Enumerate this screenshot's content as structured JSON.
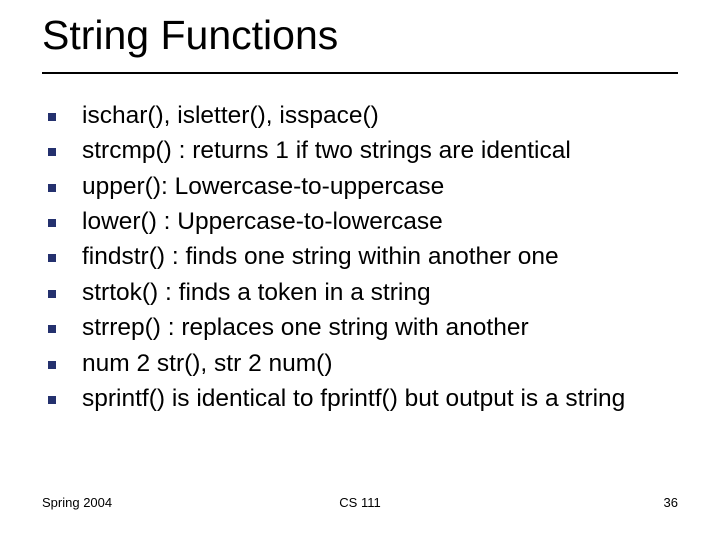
{
  "title": "String Functions",
  "bullets": [
    "ischar(), isletter(), isspace()",
    "strcmp() : returns 1 if two strings are identical",
    "upper(): Lowercase-to-uppercase",
    "lower() : Uppercase-to-lowercase",
    "findstr() : finds one string within another one",
    "strtok() : finds a token in a string",
    "strrep() : replaces one string with another",
    "num 2 str(), str 2 num()",
    "sprintf() is identical to fprintf() but output is a string"
  ],
  "footer": {
    "left": "Spring 2004",
    "center": "CS 111",
    "right": "36"
  }
}
